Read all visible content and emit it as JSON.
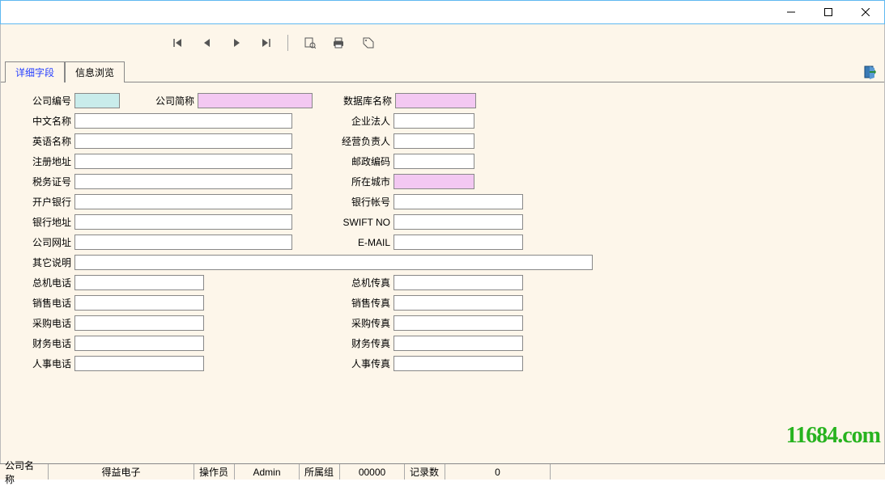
{
  "tabs": {
    "detail": "详细字段",
    "browse": "信息浏览"
  },
  "labels": {
    "company_no": "公司编号",
    "company_short": "公司简称",
    "db_name": "数据库名称",
    "cn_name": "中文名称",
    "legal_person": "企业法人",
    "en_name": "英语名称",
    "manager": "经营负责人",
    "reg_addr": "注册地址",
    "postal": "邮政编码",
    "tax_no": "税务证号",
    "city": "所在城市",
    "bank": "开户银行",
    "bank_acct": "银行帐号",
    "bank_addr": "银行地址",
    "swift": "SWIFT NO",
    "website": "公司网址",
    "email": "E-MAIL",
    "other": "其它说明",
    "main_tel": "总机电话",
    "main_fax": "总机传真",
    "sales_tel": "销售电话",
    "sales_fax": "销售传真",
    "purch_tel": "采购电话",
    "purch_fax": "采购传真",
    "fin_tel": "财务电话",
    "fin_fax": "财务传真",
    "hr_tel": "人事电话",
    "hr_fax": "人事传真"
  },
  "values": {
    "company_no": "",
    "company_short": "",
    "db_name": "",
    "cn_name": "",
    "legal_person": "",
    "en_name": "",
    "manager": "",
    "reg_addr": "",
    "postal": "",
    "tax_no": "",
    "city": "",
    "bank": "",
    "bank_acct": "",
    "bank_addr": "",
    "swift": "",
    "website": "",
    "email": "",
    "other": "",
    "main_tel": "",
    "main_fax": "",
    "sales_tel": "",
    "sales_fax": "",
    "purch_tel": "",
    "purch_fax": "",
    "fin_tel": "",
    "fin_fax": "",
    "hr_tel": "",
    "hr_fax": ""
  },
  "status": {
    "company_label": "公司名称",
    "company_value": "得益电子",
    "operator_label": "操作员",
    "operator_value": "Admin",
    "group_label": "所属组",
    "group_value": "00000",
    "records_label": "记录数",
    "records_value": "0"
  },
  "watermark": "11684.com"
}
